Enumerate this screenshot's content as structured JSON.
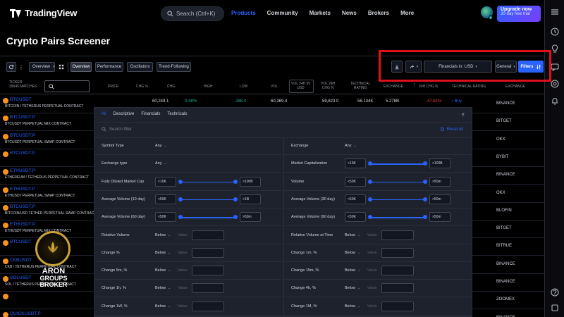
{
  "app": {
    "brand": "TradingView",
    "upgrade_line1": "Upgrade now",
    "upgrade_line2": "30-day free trial"
  },
  "search": {
    "placeholder": "Search (Ctrl+K)"
  },
  "nav": {
    "items": [
      "Products",
      "Community",
      "Markets",
      "News",
      "Brokers",
      "More"
    ],
    "active": "Products"
  },
  "page": {
    "title": "Crypto Pairs Screener"
  },
  "toolbar": {
    "view_select": "Overview",
    "tabs": [
      "Overview",
      "Performance",
      "Oscillators",
      "Trend-Following"
    ],
    "active_tab": "Overview",
    "financials": "Financials in: USD",
    "general": "General",
    "filters": "Filters"
  },
  "table": {
    "headers": {
      "ticker": "TICKER",
      "matches": "39645 MATCHES",
      "price": "PRICE",
      "chg_pct": "CHG %",
      "chg": "CHG",
      "high": "HIGH",
      "low": "LOW",
      "vol": "VOL",
      "vol24_usd_1": "VOL 24H IN",
      "vol24_usd_2": "USD",
      "vol24_chg_1": "VOL 24H",
      "vol24_chg_2": "CHG %",
      "tech_1": "TECHNICAL",
      "tech_2": "RATING",
      "exchange": "EXCHANGE",
      "chg24": "24H CHG %",
      "tech_rating": "TECHNICAL RATING",
      "exchange2": "EXCHANGE"
    },
    "rows": [
      {
        "ticker": "BTCUSDT",
        "description": "BITCOIN / TETHERUS PERPETUAL CONTRACT",
        "exchange": "BINANCE",
        "price": "60,249.1",
        "chg_pct": "0.48%",
        "high": "288.4",
        "low": "60,369.4",
        "vol24": "59,823.0",
        "vol24chg": "56.134K",
        "tech": "5.278B",
        "chg24": "-47.61%",
        "rating": "↓ Buy"
      },
      {
        "ticker": "BTCUSDT.P",
        "description": "BTCUSDT PERPETUAL MIX CONTRACT",
        "exchange": "BITGET"
      },
      {
        "ticker": "BTCUSDT.P",
        "description": "BTCUSDT PERPETUAL SWAP CONTRACT",
        "exchange": "OKX"
      },
      {
        "ticker": "BTCUSDT.P",
        "description": "",
        "exchange": "BYBIT"
      },
      {
        "ticker": "ETHUSDT.P",
        "description": "ETHEREUM / TETHERUS PERPETUAL CONTRACT",
        "exchange": "BINANCE"
      },
      {
        "ticker": "ETHUSDT.P",
        "description": "ETHUSDT PERPETUAL SWAP CONTRACT",
        "exchange": "OKX"
      },
      {
        "ticker": "BTCUSDT.P",
        "description": "BITCOIN/USD TETHER PERPETUAL SWAP CONTRACT",
        "exchange": "BLOFIN"
      },
      {
        "ticker": "ETHUSDT.P",
        "description": "ETHUSDT PERPETUAL MIX CONTRACT",
        "exchange": "BITGET"
      },
      {
        "ticker": "BTCUSDT",
        "description": "",
        "exchange": "BITRUE"
      },
      {
        "ticker": "CKBUSDT",
        "description": "CKB / TETHERUS PERPETUAL CONTRACT",
        "exchange": "BINANCE"
      },
      {
        "ticker": "SOLUSDT",
        "description": "SOL / TETHERUS PERPETUAL CONTRACT",
        "exchange": "BINANCE"
      },
      {
        "ticker": "",
        "description": "",
        "exchange": "ZOOMEX"
      },
      {
        "ticker": "QUICKUSDT.P",
        "description": "",
        "exchange": "BINANCE"
      }
    ]
  },
  "panel": {
    "tabs": [
      "All",
      "Descriptive",
      "Financials",
      "Technicals"
    ],
    "active_tab": "All",
    "close": "×",
    "search_placeholder": "Search filter",
    "reset": "Reset all",
    "value_label": "Value",
    "left": [
      {
        "label": "Symbol Type",
        "type": "dd",
        "dd": "Any"
      },
      {
        "label": "Exchange type",
        "type": "dd",
        "dd": "Any"
      },
      {
        "label": "Fully Diluted Market Cap",
        "type": "range",
        "min": "<10K",
        "max": ">100B",
        "min_pos": 0.0,
        "max_pos": 1.0
      },
      {
        "label": "Average Volume (10 day)",
        "type": "range",
        "min": "<50K",
        "max": ">1B",
        "min_pos": 0.0,
        "max_pos": 1.0
      },
      {
        "label": "Average Volume (60 day)",
        "type": "range",
        "min": "<50K",
        "max": ">50m",
        "min_pos": 0.0,
        "max_pos": 1.0
      },
      {
        "label": "Relative Volume",
        "type": "cmp",
        "dd": "Below"
      },
      {
        "label": "Change %",
        "type": "cmp",
        "dd": "Below"
      },
      {
        "label": "Change 5m, %",
        "type": "cmp",
        "dd": "Below"
      },
      {
        "label": "Change 1h, %",
        "type": "cmp",
        "dd": "Below"
      },
      {
        "label": "Change 1W, %",
        "type": "cmp",
        "dd": "Below"
      }
    ],
    "right": [
      {
        "label": "Exchange",
        "type": "dd",
        "dd": "Any"
      },
      {
        "label": "Market Capitalization",
        "type": "range",
        "min": "<10K",
        "max": ">100B",
        "min_pos": 0.0,
        "max_pos": 1.0
      },
      {
        "label": "Volume",
        "type": "range",
        "min": "<50K",
        "max": ">50m",
        "min_pos": 0.0,
        "max_pos": 1.0
      },
      {
        "label": "Average Volume (30 day)",
        "type": "range",
        "min": "<50K",
        "max": ">50m",
        "min_pos": 0.0,
        "max_pos": 1.0
      },
      {
        "label": "Average Volume (90 day)",
        "type": "range",
        "min": "<50K",
        "max": ">50m",
        "min_pos": 0.0,
        "max_pos": 1.0
      },
      {
        "label": "Relative Volume at Time",
        "type": "cmp",
        "dd": "Below"
      },
      {
        "label": "Change 1m, %",
        "type": "cmp",
        "dd": "Below"
      },
      {
        "label": "Change 15m, %",
        "type": "cmp",
        "dd": "Below"
      },
      {
        "label": "Change 4h, %",
        "type": "cmp",
        "dd": "Below"
      },
      {
        "label": "Change 1M, %",
        "type": "cmp",
        "dd": "Below"
      }
    ]
  },
  "watermark": {
    "line1": "ARON",
    "line2": "GROUPS",
    "line3": "BROKER"
  },
  "colors": {
    "accent": "#2962ff",
    "highlight": "#e0101a",
    "up": "#22ab94",
    "down": "#f23645",
    "gold": "#c9a23a"
  }
}
